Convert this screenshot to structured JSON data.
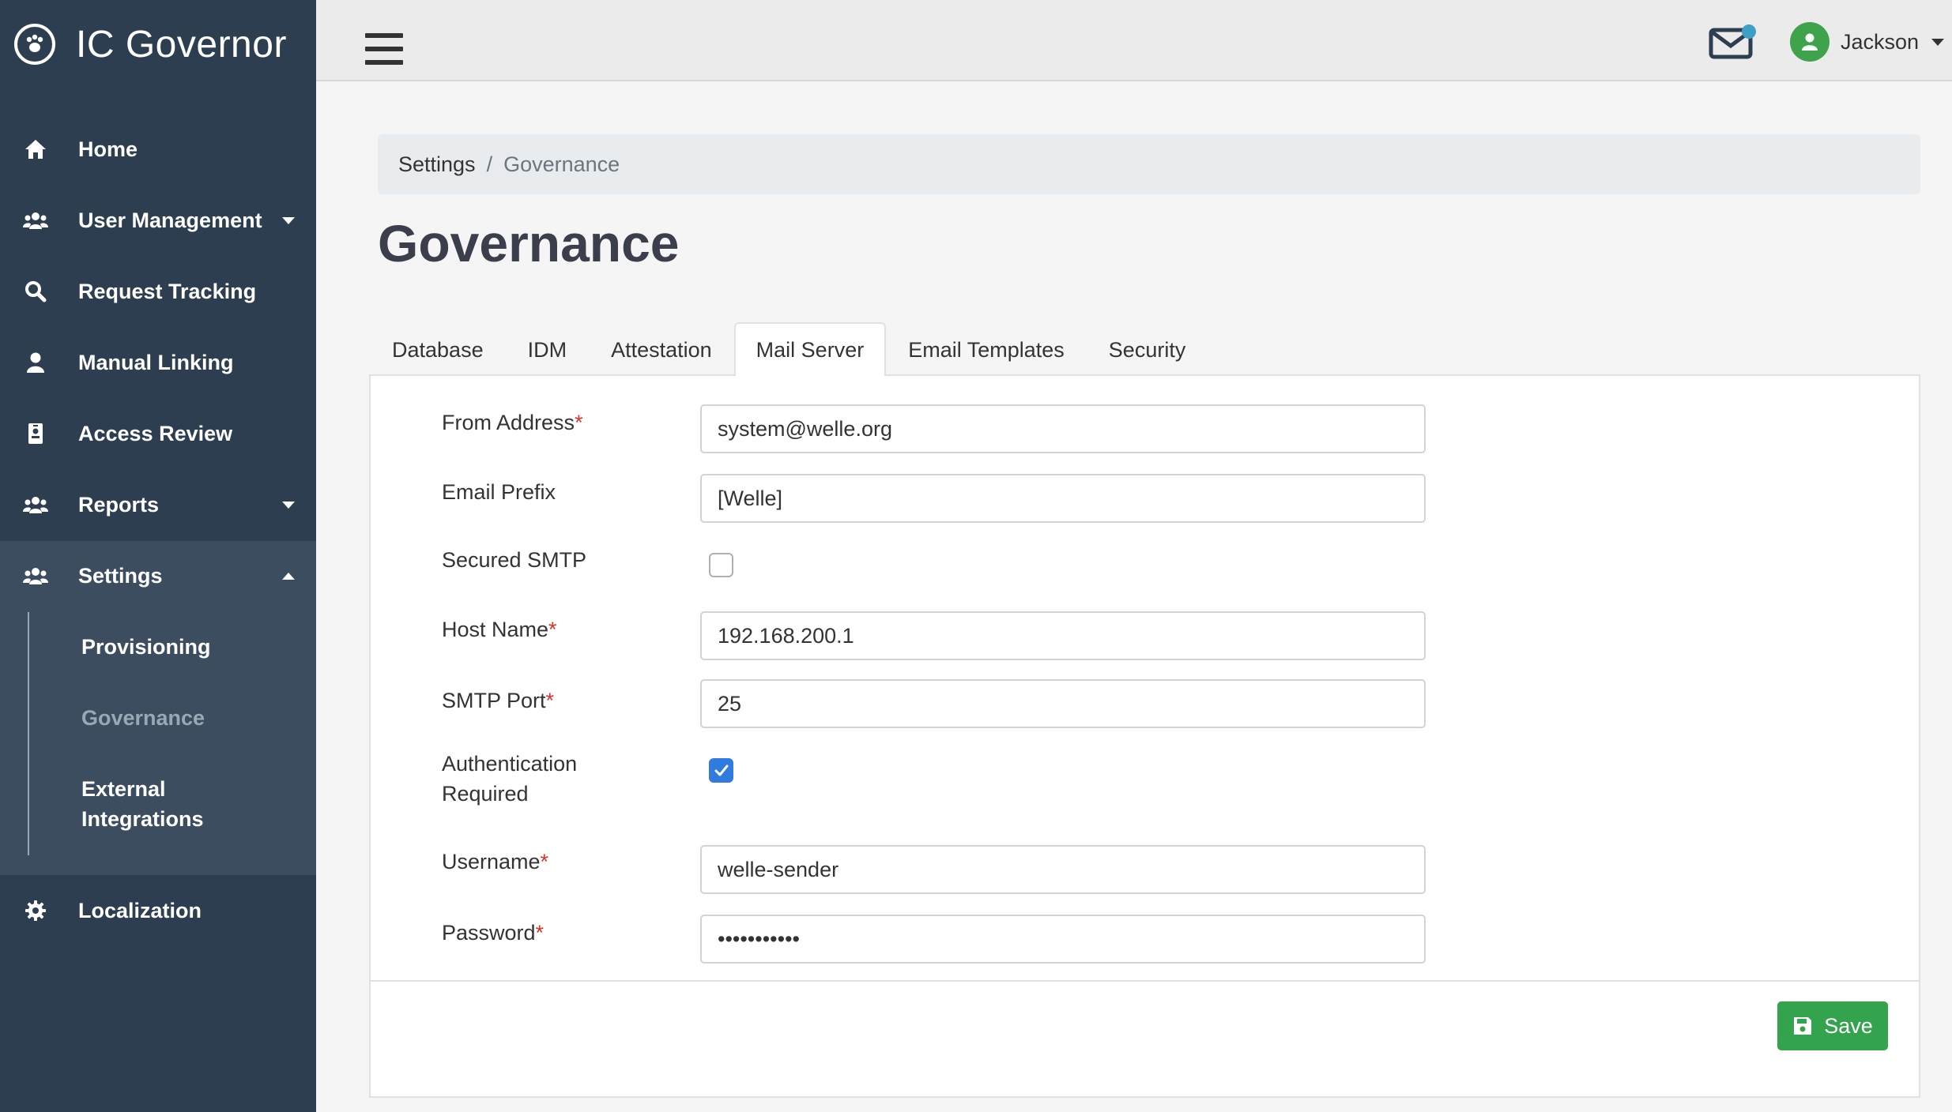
{
  "app": {
    "title": "IC Governor"
  },
  "sidebar": {
    "items": [
      {
        "label": "Home",
        "icon": "home-icon"
      },
      {
        "label": "User Management",
        "icon": "users-icon",
        "expandable": true
      },
      {
        "label": "Request Tracking",
        "icon": "search-icon"
      },
      {
        "label": "Manual Linking",
        "icon": "user-icon"
      },
      {
        "label": "Access Review",
        "icon": "id-badge-icon"
      },
      {
        "label": "Reports",
        "icon": "users-icon",
        "expandable": true
      },
      {
        "label": "Settings",
        "icon": "users-icon",
        "expanded": true
      },
      {
        "label": "Localization",
        "icon": "gear-icon"
      }
    ],
    "settings_sub": [
      {
        "label": "Provisioning"
      },
      {
        "label": "Governance",
        "active": true
      },
      {
        "label": "External Integrations",
        "line1": "External",
        "line2": "Integrations"
      }
    ]
  },
  "topbar": {
    "user_name": "Jackson",
    "notification_badge_color": "#3c9fc5"
  },
  "breadcrumb": {
    "parent": "Settings",
    "separator": "/",
    "current": "Governance"
  },
  "page_title": "Governance",
  "tabs": [
    {
      "label": "Database"
    },
    {
      "label": "IDM"
    },
    {
      "label": "Attestation"
    },
    {
      "label": "Mail Server",
      "active": true
    },
    {
      "label": "Email Templates"
    },
    {
      "label": "Security"
    }
  ],
  "form": {
    "from_address": {
      "label": "From Address",
      "required": "*",
      "value": "system@welle.org"
    },
    "email_prefix": {
      "label": "Email Prefix",
      "value": "[Welle]"
    },
    "secured_smtp": {
      "label": "Secured SMTP",
      "checked": false
    },
    "host_name": {
      "label": "Host Name",
      "required": "*",
      "value": "192.168.200.1"
    },
    "smtp_port": {
      "label": "SMTP Port",
      "required": "*",
      "value": "25"
    },
    "auth_required": {
      "label_line1": "Authentication",
      "label_line2": "Required",
      "checked": true
    },
    "username": {
      "label": "Username",
      "required": "*",
      "value": "welle-sender"
    },
    "password": {
      "label": "Password",
      "required": "*",
      "value": "•••••••••••"
    }
  },
  "actions": {
    "save_label": "Save"
  },
  "colors": {
    "sidebar_bg": "#2c3e50",
    "save_button": "#33a34d",
    "checkbox_checked": "#2f7be0",
    "avatar": "#3ea34b",
    "required_marker": "#d9342b"
  }
}
